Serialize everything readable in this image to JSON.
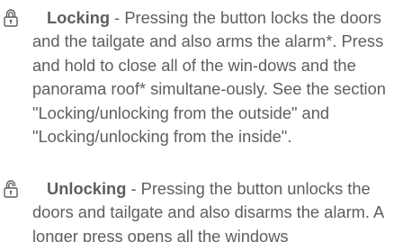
{
  "entries": [
    {
      "icon": "locked-padlock-icon",
      "term": "Locking",
      "separator": " - ",
      "text": "Pressing the button locks the doors and the tailgate and also arms the alarm*. Press and hold to close all of the win-dows and the panorama roof* simultane-ously. See the section \"Locking/unlocking from the outside\" and \"Locking/unlocking from the inside\"."
    },
    {
      "icon": "unlocked-padlock-icon",
      "term": "Unlocking",
      "separator": " - ",
      "text": "Pressing the button unlocks the doors and tailgate and also disarms the alarm. A longer press opens all the windows"
    }
  ],
  "colors": {
    "text": "#5d5e60",
    "icon": "#5d5e60"
  }
}
